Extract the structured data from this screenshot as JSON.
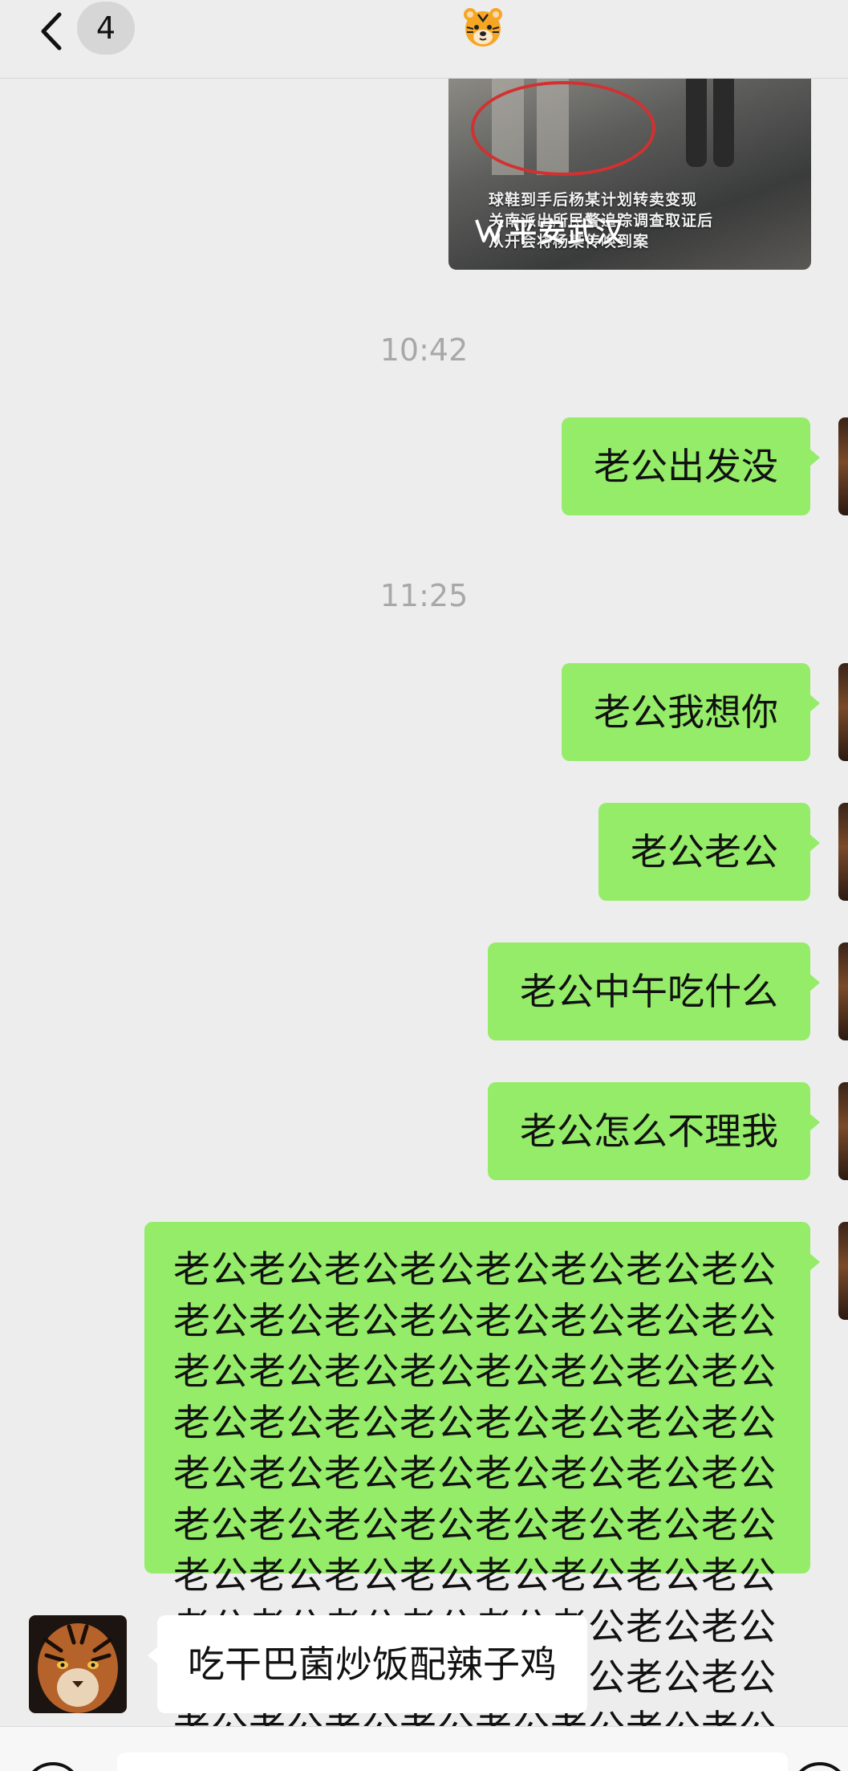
{
  "header": {
    "unread_count": "4",
    "contact_name_emoji": "🐯"
  },
  "shared_image": {
    "caption_line1": "球鞋到手后杨某计划转卖变现",
    "caption_line2": "关南派出所民警追踪调查取证后",
    "caption_line3": "从开会将杨某传唤到案",
    "watermark": "平安武汉"
  },
  "messages": [
    {
      "type": "time",
      "text": "10:42"
    },
    {
      "type": "outgoing",
      "text": "老公出发没"
    },
    {
      "type": "time",
      "text": "11:25"
    },
    {
      "type": "outgoing",
      "text": "老公我想你"
    },
    {
      "type": "outgoing",
      "text": "老公老公"
    },
    {
      "type": "outgoing",
      "text": "老公中午吃什么"
    },
    {
      "type": "outgoing",
      "text": "老公怎么不理我"
    },
    {
      "type": "outgoing",
      "text": "老公老公老公老公老公老公老公老公老公老公老公老公老公老公老公老公老公老公老公老公老公老公老公老公老公老公老公老公老公老公老公老公老公老公老公老公老公老公老公老公老公老公老公老公老公老公老公老公老公老公老公老公老公老公老公老公老公老公老公老公老公老公老公老公老公老公老公老公老公老公老公老公老公老公老公老公老公老公老公老公老公老公老公老公老公老公老公老公老公老公老公老公老公老公老公老公老公老公老公老公老公老公老公老公老公老公老公老公老公老公老公老公老公老公老公老公老公老公老公老公老公老公老公老公老公老公老公老公老公老公老公老公老公老公"
    },
    {
      "type": "incoming",
      "text": "吃干巴菌炒饭配辣子鸡"
    }
  ],
  "colors": {
    "background": "#ededed",
    "outgoing_bubble": "#95ec69",
    "incoming_bubble": "#ffffff",
    "timestamp_text": "#a8a8a8"
  },
  "icons": [
    "back-icon",
    "tiger-emoji-icon",
    "voice-icon",
    "add-icon"
  ]
}
